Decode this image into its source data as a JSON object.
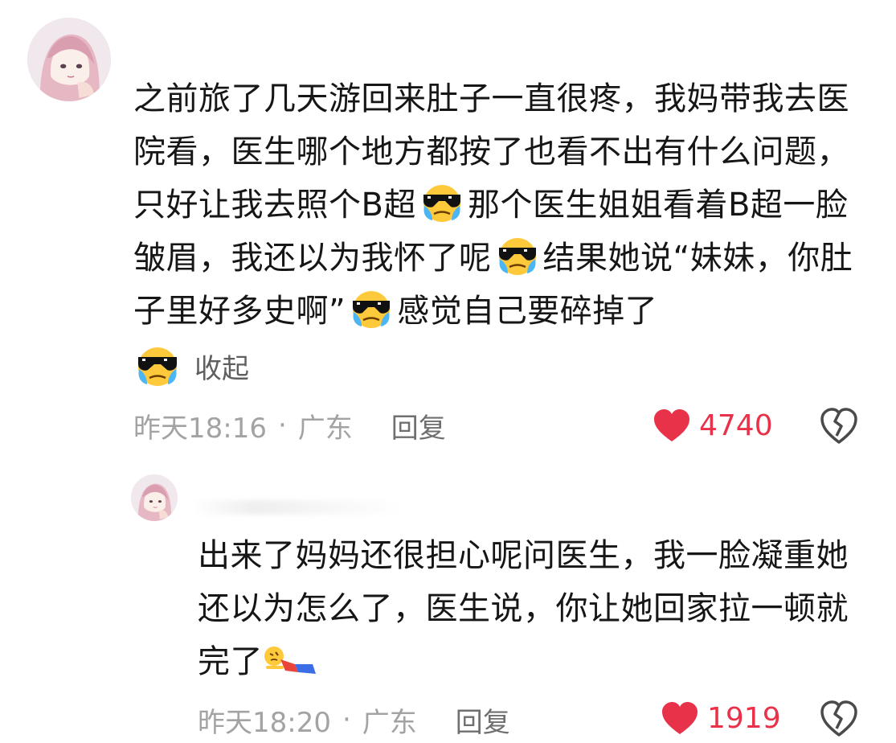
{
  "comments": [
    {
      "segments": [
        "之前旅了几天游回来肚子一直很疼，我妈带我去医院看，医生哪个地方都按了也看不出有什么问题，只好让我去照个B超",
        "那个医生姐姐看着B超一脸皱眉，我还以为我怀了呢",
        "结果她说“妹妹，你肚子里好多史啊”",
        "感觉自己要碎掉了"
      ],
      "emojis": [
        "sunglasses-crying-icon",
        "sunglasses-crying-icon",
        "sunglasses-crying-icon",
        "sunglasses-crying-icon"
      ],
      "collapse_label": "收起",
      "time": "昨天18:16",
      "separator": "·",
      "location": "广东",
      "reply_label": "回复",
      "likes": "4740"
    },
    {
      "segments": [
        "出来了妈妈还很担心呢问医生，我一脸凝重她还以为怎么了，医生说，你让她回家拉一顿就完了"
      ],
      "emojis": [
        "lying-down-emoji-icon"
      ],
      "time": "昨天18:20",
      "separator": "·",
      "location": "广东",
      "reply_label": "回复",
      "likes": "1919"
    }
  ],
  "colors": {
    "like_red": "#e8324a",
    "meta_gray": "#a3a3a3",
    "text": "#161616"
  }
}
